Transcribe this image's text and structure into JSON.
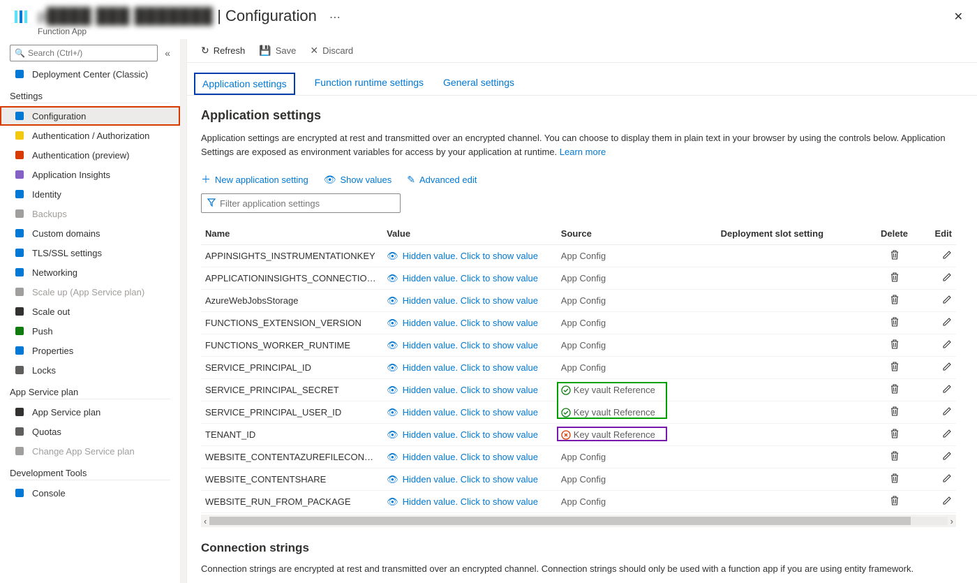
{
  "header": {
    "title_obscured": "p████ ███ ███████",
    "title_suffix": " | Configuration",
    "subtitle": "Function App",
    "more": "⋯"
  },
  "search": {
    "placeholder": "Search (Ctrl+/)"
  },
  "sidebar": {
    "items": [
      {
        "icon": "deployment",
        "label": "Deployment Center (Classic)",
        "color": "#0078d4"
      }
    ],
    "settings_title": "Settings",
    "settings_items": [
      {
        "icon": "config",
        "label": "Configuration",
        "active": true,
        "highlighted": true,
        "color": "#0078d4"
      },
      {
        "icon": "key",
        "label": "Authentication / Authorization",
        "color": "#f2c811"
      },
      {
        "icon": "auth",
        "label": "Authentication (preview)",
        "color": "#d83b01"
      },
      {
        "icon": "bulb",
        "label": "Application Insights",
        "color": "#8661c5"
      },
      {
        "icon": "identity",
        "label": "Identity",
        "color": "#0078d4"
      },
      {
        "icon": "backup",
        "label": "Backups",
        "disabled": true,
        "color": "#a19f9d"
      },
      {
        "icon": "domain",
        "label": "Custom domains",
        "color": "#0078d4"
      },
      {
        "icon": "shield",
        "label": "TLS/SSL settings",
        "color": "#0078d4"
      },
      {
        "icon": "network",
        "label": "Networking",
        "color": "#0078d4"
      },
      {
        "icon": "scaleup",
        "label": "Scale up (App Service plan)",
        "disabled": true,
        "color": "#a19f9d"
      },
      {
        "icon": "scaleout",
        "label": "Scale out",
        "color": "#323130"
      },
      {
        "icon": "push",
        "label": "Push",
        "color": "#107c10"
      },
      {
        "icon": "props",
        "label": "Properties",
        "color": "#0078d4"
      },
      {
        "icon": "lock",
        "label": "Locks",
        "color": "#605e5c"
      }
    ],
    "asp_title": "App Service plan",
    "asp_items": [
      {
        "icon": "asp",
        "label": "App Service plan",
        "color": "#323130"
      },
      {
        "icon": "quota",
        "label": "Quotas",
        "color": "#605e5c"
      },
      {
        "icon": "change",
        "label": "Change App Service plan",
        "disabled": true,
        "color": "#a19f9d"
      }
    ],
    "dev_title": "Development Tools",
    "dev_items": [
      {
        "icon": "console",
        "label": "Console",
        "color": "#0078d4"
      }
    ]
  },
  "toolbar": {
    "refresh": "Refresh",
    "save": "Save",
    "discard": "Discard"
  },
  "tabs": [
    {
      "label": "Application settings",
      "active": true
    },
    {
      "label": "Function runtime settings"
    },
    {
      "label": "General settings"
    }
  ],
  "section_title": "Application settings",
  "description": "Application settings are encrypted at rest and transmitted over an encrypted channel. You can choose to display them in plain text in your browser by using the controls below. Application Settings are exposed as environment variables for access by your application at runtime. ",
  "learn_more": "Learn more",
  "actions": {
    "new": "New application setting",
    "show": "Show values",
    "advanced": "Advanced edit"
  },
  "filter_placeholder": "Filter application settings",
  "table": {
    "headers": {
      "name": "Name",
      "value": "Value",
      "source": "Source",
      "slot": "Deployment slot setting",
      "delete": "Delete",
      "edit": "Edit"
    },
    "hidden_text": "Hidden value. Click to show value",
    "rows": [
      {
        "name": "APPINSIGHTS_INSTRUMENTATIONKEY",
        "source": "App Config"
      },
      {
        "name": "APPLICATIONINSIGHTS_CONNECTION_STRIN",
        "source": "App Config"
      },
      {
        "name": "AzureWebJobsStorage",
        "source": "App Config"
      },
      {
        "name": "FUNCTIONS_EXTENSION_VERSION",
        "source": "App Config"
      },
      {
        "name": "FUNCTIONS_WORKER_RUNTIME",
        "source": "App Config"
      },
      {
        "name": "SERVICE_PRINCIPAL_ID",
        "source": "App Config"
      },
      {
        "name": "SERVICE_PRINCIPAL_SECRET",
        "source": "Key vault Reference",
        "status": "ok"
      },
      {
        "name": "SERVICE_PRINCIPAL_USER_ID",
        "source": "Key vault Reference",
        "status": "ok"
      },
      {
        "name": "TENANT_ID",
        "source": "Key vault Reference",
        "status": "error"
      },
      {
        "name": "WEBSITE_CONTENTAZUREFILECONNECTIONS",
        "source": "App Config"
      },
      {
        "name": "WEBSITE_CONTENTSHARE",
        "source": "App Config"
      },
      {
        "name": "WEBSITE_RUN_FROM_PACKAGE",
        "source": "App Config"
      }
    ]
  },
  "connection_title": "Connection strings",
  "connection_desc": "Connection strings are encrypted at rest and transmitted over an encrypted channel. Connection strings should only be used with a function app if you are using entity framework."
}
